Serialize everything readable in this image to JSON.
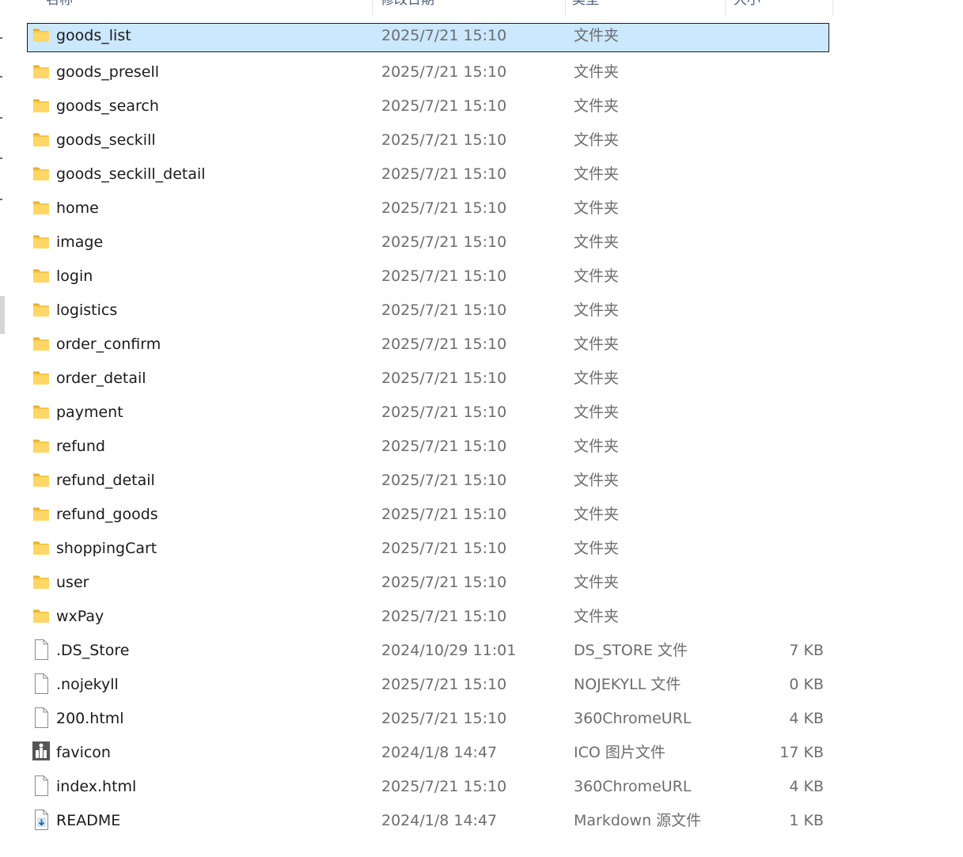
{
  "columns": {
    "name": "名称",
    "date": "修改日期",
    "type": "类型",
    "size": "大小"
  },
  "files": [
    {
      "name": "goods_list",
      "date": "2025/7/21 15:10",
      "type": "文件夹",
      "size": "",
      "icon": "folder-icon",
      "selected": true
    },
    {
      "name": "goods_presell",
      "date": "2025/7/21 15:10",
      "type": "文件夹",
      "size": "",
      "icon": "folder-icon"
    },
    {
      "name": "goods_search",
      "date": "2025/7/21 15:10",
      "type": "文件夹",
      "size": "",
      "icon": "folder-icon"
    },
    {
      "name": "goods_seckill",
      "date": "2025/7/21 15:10",
      "type": "文件夹",
      "size": "",
      "icon": "folder-icon"
    },
    {
      "name": "goods_seckill_detail",
      "date": "2025/7/21 15:10",
      "type": "文件夹",
      "size": "",
      "icon": "folder-icon"
    },
    {
      "name": "home",
      "date": "2025/7/21 15:10",
      "type": "文件夹",
      "size": "",
      "icon": "folder-icon"
    },
    {
      "name": "image",
      "date": "2025/7/21 15:10",
      "type": "文件夹",
      "size": "",
      "icon": "folder-icon"
    },
    {
      "name": "login",
      "date": "2025/7/21 15:10",
      "type": "文件夹",
      "size": "",
      "icon": "folder-icon"
    },
    {
      "name": "logistics",
      "date": "2025/7/21 15:10",
      "type": "文件夹",
      "size": "",
      "icon": "folder-icon"
    },
    {
      "name": "order_confirm",
      "date": "2025/7/21 15:10",
      "type": "文件夹",
      "size": "",
      "icon": "folder-icon"
    },
    {
      "name": "order_detail",
      "date": "2025/7/21 15:10",
      "type": "文件夹",
      "size": "",
      "icon": "folder-icon"
    },
    {
      "name": "payment",
      "date": "2025/7/21 15:10",
      "type": "文件夹",
      "size": "",
      "icon": "folder-icon"
    },
    {
      "name": "refund",
      "date": "2025/7/21 15:10",
      "type": "文件夹",
      "size": "",
      "icon": "folder-icon"
    },
    {
      "name": "refund_detail",
      "date": "2025/7/21 15:10",
      "type": "文件夹",
      "size": "",
      "icon": "folder-icon"
    },
    {
      "name": "refund_goods",
      "date": "2025/7/21 15:10",
      "type": "文件夹",
      "size": "",
      "icon": "folder-icon"
    },
    {
      "name": "shoppingCart",
      "date": "2025/7/21 15:10",
      "type": "文件夹",
      "size": "",
      "icon": "folder-icon"
    },
    {
      "name": "user",
      "date": "2025/7/21 15:10",
      "type": "文件夹",
      "size": "",
      "icon": "folder-icon"
    },
    {
      "name": "wxPay",
      "date": "2025/7/21 15:10",
      "type": "文件夹",
      "size": "",
      "icon": "folder-icon"
    },
    {
      "name": ".DS_Store",
      "date": "2024/10/29 11:01",
      "type": "DS_STORE 文件",
      "size": "7 KB",
      "icon": "file-icon"
    },
    {
      "name": ".nojekyll",
      "date": "2025/7/21 15:10",
      "type": "NOJEKYLL 文件",
      "size": "0 KB",
      "icon": "file-icon"
    },
    {
      "name": "200.html",
      "date": "2025/7/21 15:10",
      "type": "360ChromeURL",
      "size": "4 KB",
      "icon": "file-icon"
    },
    {
      "name": "favicon",
      "date": "2024/1/8 14:47",
      "type": "ICO 图片文件",
      "size": "17 KB",
      "icon": "favicon-image-icon"
    },
    {
      "name": "index.html",
      "date": "2025/7/21 15:10",
      "type": "360ChromeURL",
      "size": "4 KB",
      "icon": "file-icon"
    },
    {
      "name": "README",
      "date": "2024/1/8 14:47",
      "type": "Markdown 源文件",
      "size": "1 KB",
      "icon": "markdown-file-icon"
    }
  ],
  "colors": {
    "selection_bg": "#cce8ff",
    "folder": "#f8c74a",
    "folder_dark": "#e8ad2a",
    "secondary_text": "#6d6d6d"
  }
}
